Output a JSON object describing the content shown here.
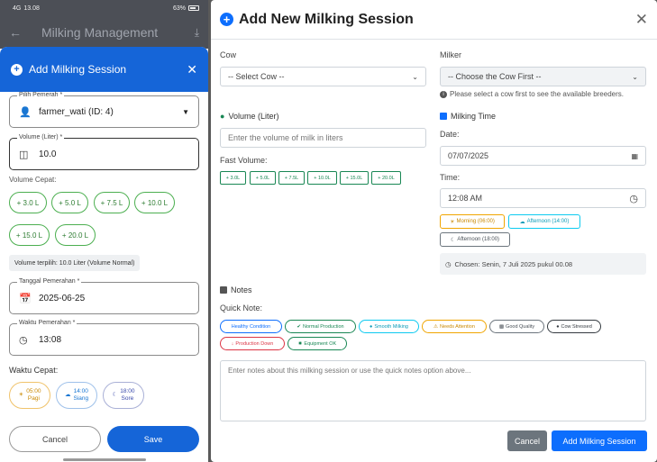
{
  "status_bar": {
    "time": "13.08",
    "signal": "4G",
    "battery": "63%"
  },
  "mobile_app": {
    "appbar_title": "Milking Management",
    "sheet_title": "Add Milking Session",
    "milker_label": "Pilih Pemerah *",
    "milker_value": "farmer_wati (ID: 4)",
    "volume_label": "Volume (Liter) *",
    "volume_value": "10.0",
    "quick_volume_label": "Volume Cepat:",
    "quick_volumes": [
      "+ 3.0 L",
      "+ 5.0 L",
      "+ 7.5 L",
      "+ 10.0 L",
      "+ 15.0 L",
      "+ 20.0 L"
    ],
    "volume_selected_note": "Volume terpilih: 10.0 Liter (Volume Normal)",
    "date_label": "Tanggal Pemerahan *",
    "date_value": "2025-06-25",
    "time_label": "Waktu Pemerahan *",
    "time_value": "13:08",
    "quick_time_label": "Waktu Cepat:",
    "quick_times": [
      {
        "time": "05:00",
        "name": "Pagi",
        "color": "#e6a100"
      },
      {
        "time": "14:00",
        "name": "Siang",
        "color": "#1976d2"
      },
      {
        "time": "18:00",
        "name": "Sore",
        "color": "#3949ab"
      }
    ],
    "cancel_label": "Cancel",
    "save_label": "Save"
  },
  "modal": {
    "title": "Add New Milking Session",
    "cow_label": "Cow",
    "cow_select": "-- Select Cow --",
    "milker_label": "Milker",
    "milker_select": "-- Choose the Cow First --",
    "milker_help": "Please select a cow first to see the available breeders.",
    "volume_label": "Volume (Liter)",
    "volume_placeholder": "Enter the volume of milk in liters",
    "fast_volume_label": "Fast Volume:",
    "fast_volumes": [
      "3.0L",
      "5.0L",
      "7.5L",
      "10.0L",
      "15.0L",
      "20.0L"
    ],
    "milking_time_label": "Milking Time",
    "date_label": "Date:",
    "date_value": "07/07/2025",
    "time_label": "Time:",
    "time_value": "12:08 AM",
    "slots": [
      {
        "label": "Morning (06:00)",
        "color": "#f0a500"
      },
      {
        "label": "Afternoon (14:00)",
        "color": "#0dcaf0"
      },
      {
        "label": "Afternoon (18:00)",
        "color": "#6c757d"
      }
    ],
    "chosen": "Chosen: Senin, 7 Juli 2025 pukul 00.08",
    "notes_label": "Notes",
    "quick_note_label": "Quick Note:",
    "quick_notes": [
      {
        "label": "Healthy Condition",
        "color": "#0d6efd"
      },
      {
        "label": "Normal Production",
        "color": "#198754"
      },
      {
        "label": "Smooth Milking",
        "color": "#0dcaf0"
      },
      {
        "label": "Needs Attention",
        "color": "#f0a500"
      },
      {
        "label": "Good Quality",
        "color": "#6c757d"
      },
      {
        "label": "Cow Stressed",
        "color": "#343a40"
      },
      {
        "label": "Production Down",
        "color": "#dc3545"
      },
      {
        "label": "Equipment OK",
        "color": "#198754"
      }
    ],
    "notes_placeholder": "Enter notes about this milking session or use the quick notes option above...",
    "cancel_label": "Cancel",
    "add_label": "Add Milking Session"
  }
}
